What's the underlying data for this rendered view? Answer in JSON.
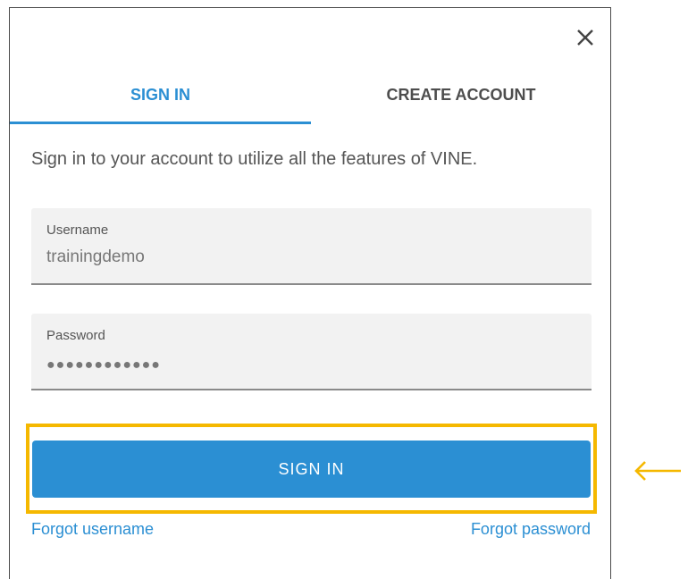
{
  "dialog": {
    "close_icon": "close-icon",
    "tabs": [
      {
        "label": "SIGN IN",
        "active": true
      },
      {
        "label": "CREATE ACCOUNT",
        "active": false
      }
    ],
    "intro": "Sign in to your account to utilize all the features of VINE.",
    "username": {
      "label": "Username",
      "value": "trainingdemo"
    },
    "password": {
      "label": "Password",
      "value": "●●●●●●●●●●●●"
    },
    "signin_button": "SIGN IN",
    "forgot_username": "Forgot username",
    "forgot_password": "Forgot password"
  },
  "annotation": {
    "highlight_color": "#f5b800",
    "arrow_icon": "left-arrow-icon"
  },
  "colors": {
    "accent": "#2b8fd3"
  }
}
